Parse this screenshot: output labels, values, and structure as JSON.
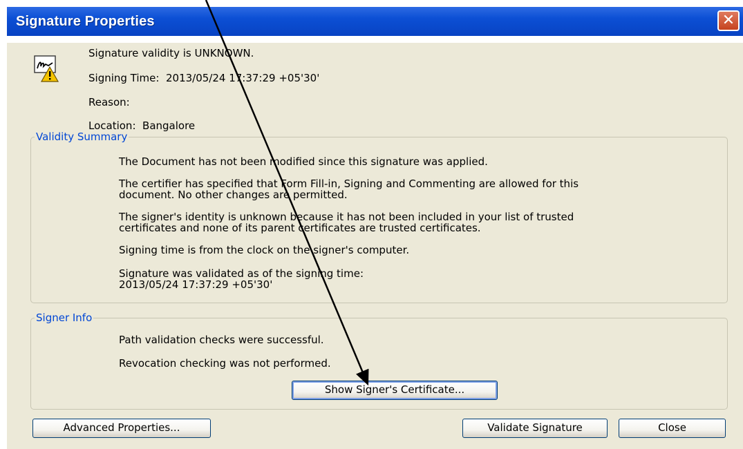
{
  "window": {
    "title": "Signature Properties",
    "close_glyph": "✕"
  },
  "header": {
    "validity": "Signature validity is UNKNOWN.",
    "signing_time": "Signing Time:  2013/05/24 17:37:29 +05'30'",
    "reason": "Reason:",
    "location": "Location:  Bangalore",
    "icon": "signature-warning-icon"
  },
  "validity_summary": {
    "legend": "Validity Summary",
    "lines": [
      "The Document has not been modified since this signature was applied.",
      "The certifier has specified that Form Fill-in, Signing and Commenting are allowed for this",
      "document. No other changes are permitted.",
      "The signer's identity is unknown because it has not been included in your list of trusted",
      "certificates and none of its parent certificates are trusted certificates.",
      "Signing time is from the clock on the signer's computer.",
      "Signature was validated as of the signing time:",
      "2013/05/24 17:37:29 +05'30'"
    ]
  },
  "signer_info": {
    "legend": "Signer Info",
    "lines": [
      "Path validation checks were successful.",
      "Revocation checking was not performed."
    ],
    "show_certificate_label": "Show Signer's Certificate..."
  },
  "buttons": {
    "advanced": "Advanced Properties...",
    "validate": "Validate Signature",
    "close": "Close"
  },
  "colors": {
    "titlebar": "#0c4fd4",
    "legend": "#0046d5",
    "face": "#ece9d8"
  }
}
